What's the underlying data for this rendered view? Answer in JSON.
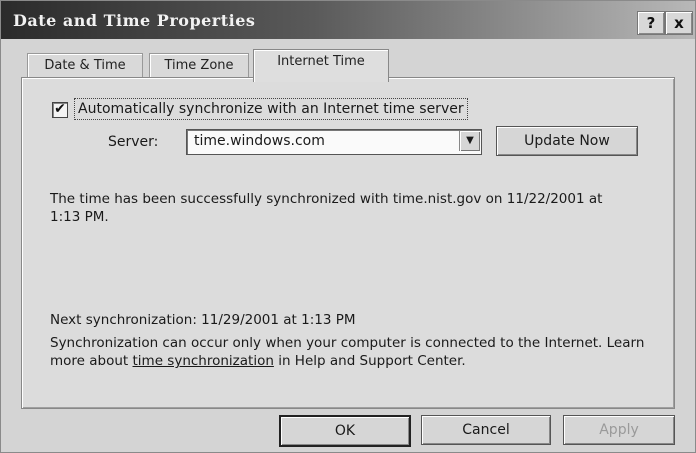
{
  "window": {
    "title": "Date and Time Properties",
    "help_label": "?",
    "close_label": "x"
  },
  "tabs": [
    {
      "label": "Date & Time",
      "active": false
    },
    {
      "label": "Time Zone",
      "active": false
    },
    {
      "label": "Internet Time",
      "active": true
    }
  ],
  "internet_time": {
    "auto_sync_checked": true,
    "check_mark": "✔",
    "auto_sync_label": "Automatically synchronize with an Internet time server",
    "server_label": "Server:",
    "server_value": "time.windows.com",
    "dropdown_arrow": "▼",
    "update_button": "Update Now",
    "status_message": "The time has been successfully synchronized with time.nist.gov on 11/22/2001 at 1:13 PM.",
    "next_sync": "Next synchronization: 11/29/2001 at 1:13 PM",
    "info_prefix": "Synchronization can occur only when your computer is connected to the Internet.  Learn more about ",
    "info_link": "time synchronization",
    "info_suffix": " in Help and Support Center."
  },
  "buttons": {
    "ok": "OK",
    "cancel": "Cancel",
    "apply": "Apply"
  },
  "icons": {
    "help": "help-icon",
    "close": "close-icon",
    "dropdown": "chevron-down-icon"
  }
}
